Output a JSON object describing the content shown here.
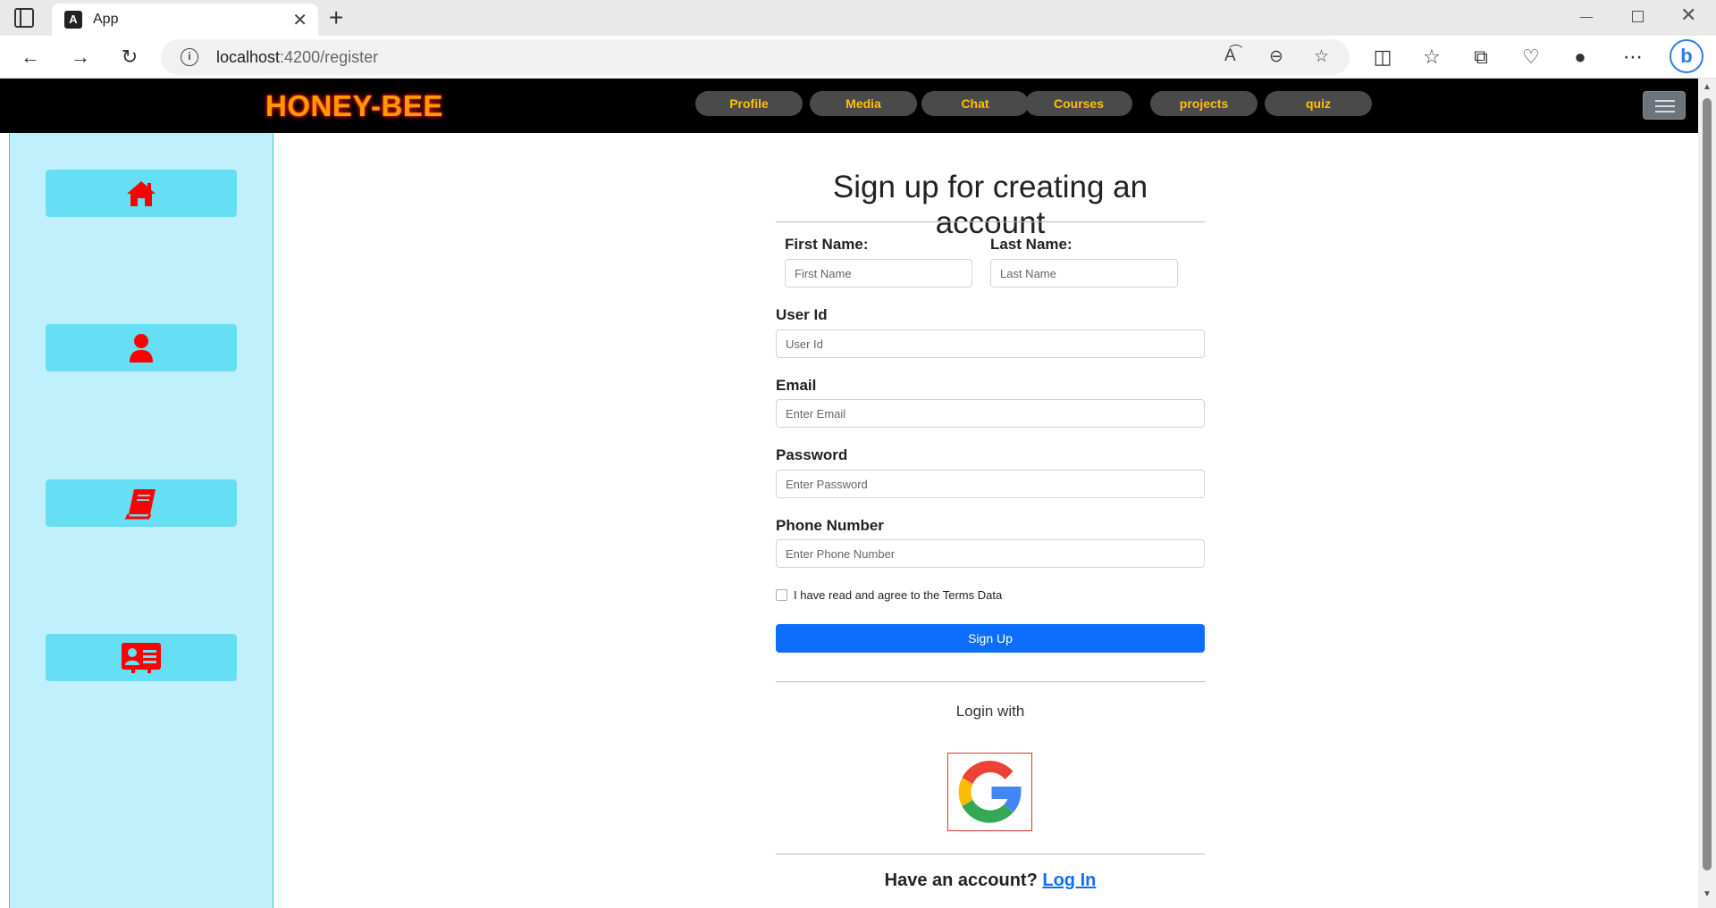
{
  "browser": {
    "tab_title": "App",
    "favicon_letter": "A",
    "url_host": "localhost",
    "url_path": ":4200/register"
  },
  "navbar": {
    "brand": "HONEY-BEE",
    "items": [
      "Profile",
      "Media",
      "Chat",
      "Courses",
      "projects",
      "quiz"
    ]
  },
  "sidebar": {
    "icons": [
      "home-icon",
      "user-icon",
      "book-icon",
      "id-card-icon"
    ]
  },
  "form": {
    "title": "Sign up for creating an account",
    "first_name_label": "First Name:",
    "first_name_placeholder": "First Name",
    "last_name_label": "Last Name:",
    "last_name_placeholder": "Last Name",
    "user_id_label": "User Id",
    "user_id_placeholder": "User Id",
    "email_label": "Email",
    "email_placeholder": "Enter Email",
    "password_label": "Password",
    "password_placeholder": "Enter Password",
    "phone_label": "Phone Number",
    "phone_placeholder": "Enter Phone Number",
    "terms_label": "I have read and agree to the Terms Data",
    "signup_label": "Sign Up",
    "login_with": "Login with",
    "have_account": "Have an account?",
    "login_link": "Log In"
  },
  "colors": {
    "accent": "#0d6efd",
    "brand": "#ff9a00",
    "nav_text": "#ffc107",
    "sidebar_bg": "#bff0fb",
    "sidebar_button": "#66dff4",
    "icon_red": "#ff0000"
  }
}
